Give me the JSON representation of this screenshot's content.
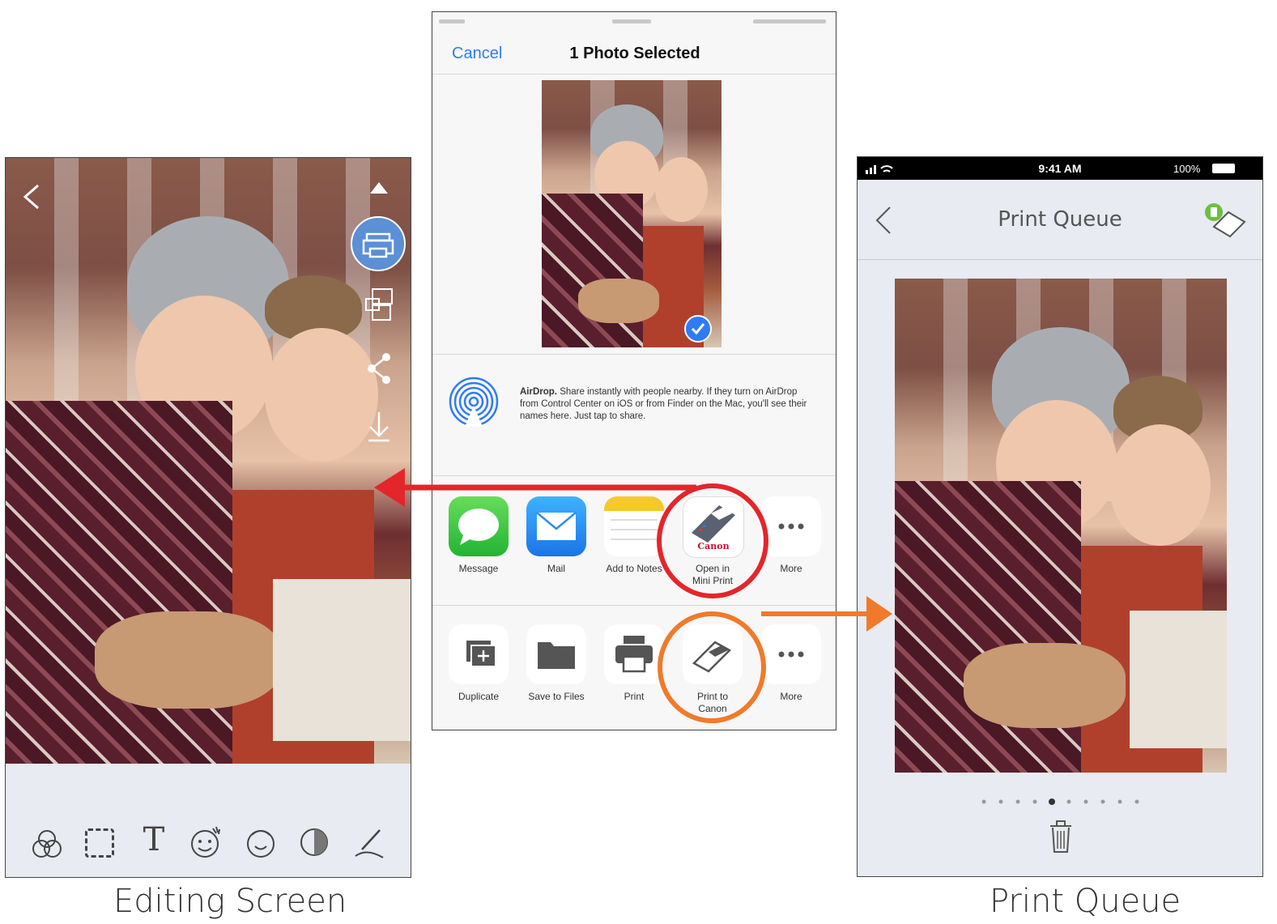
{
  "left": {
    "caption": "Editing Screen"
  },
  "share": {
    "cancel": "Cancel",
    "title": "1 Photo Selected",
    "airdrop_title": "AirDrop.",
    "airdrop_text": " Share instantly with people nearby. If they turn on AirDrop from Control Center on iOS or from Finder on the Mac, you'll see their names here. Just tap to share.",
    "apps": [
      {
        "label": "Message"
      },
      {
        "label": "Mail"
      },
      {
        "label": "Add to Notes"
      },
      {
        "label": "Open in Mini Print"
      },
      {
        "label": "More"
      }
    ],
    "canon_logo": "Canon",
    "actions": [
      {
        "label": "Duplicate"
      },
      {
        "label": "Save to Files"
      },
      {
        "label": "Print"
      },
      {
        "label": "Print to Canon"
      },
      {
        "label": "More"
      }
    ]
  },
  "right": {
    "status_time": "9:41 AM",
    "status_battery": "100%",
    "title": "Print Queue",
    "caption": "Print Queue",
    "page_dots": 10,
    "active_dot": 4
  },
  "colors": {
    "ios_blue": "#2f7bf5",
    "red_annotation": "#e3262b",
    "orange_annotation": "#f07a2a",
    "edit_button": "#5b8fd6"
  }
}
